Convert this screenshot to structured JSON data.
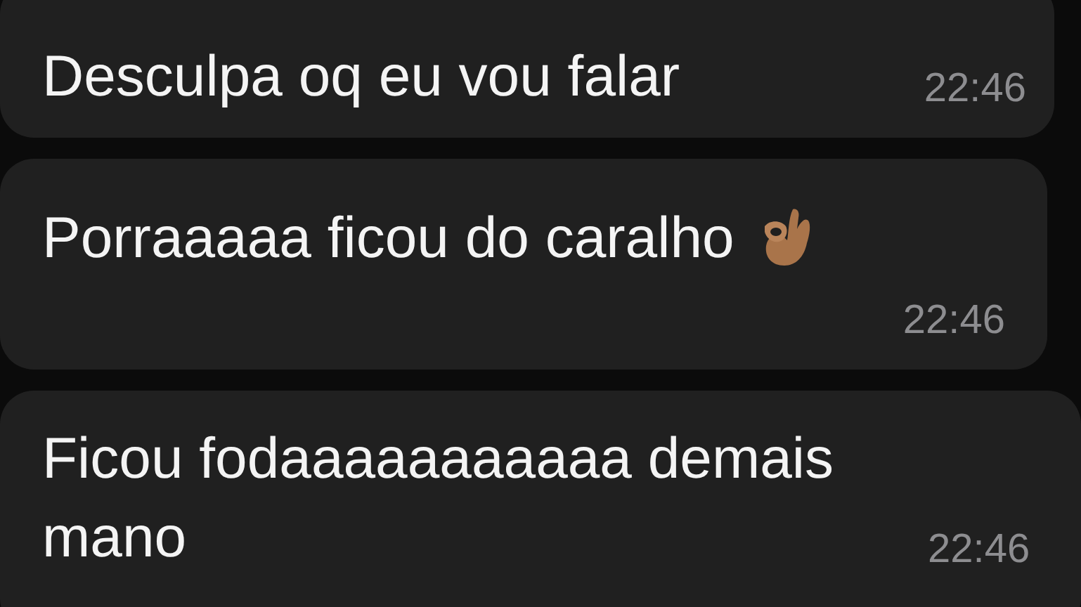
{
  "messages": [
    {
      "text": "Desculpa oq eu vou falar",
      "time": "22:46",
      "kind": "time_inline",
      "has_emoji": false
    },
    {
      "text": "Porraaaaa ficou do caralho",
      "time": "22:46",
      "kind": "time_below",
      "has_emoji": true
    },
    {
      "text": "Ficou fodaaaaaaaaaaa demais mano",
      "time": "22:46",
      "kind": "time_inline",
      "has_emoji": false
    }
  ]
}
